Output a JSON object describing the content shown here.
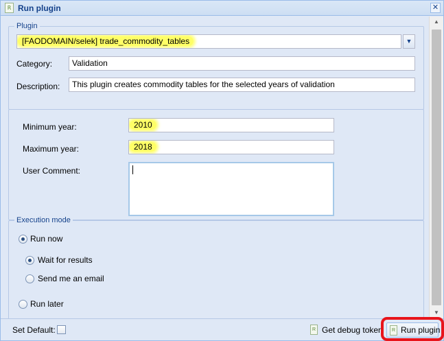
{
  "window": {
    "title": "Run plugin",
    "title_icon": "plugin-icon",
    "close_icon": "close-icon"
  },
  "plugin_section": {
    "legend": "Plugin",
    "selected_prefix": "[FAODOMAIN/selek]",
    "selected_name": "trade_commodity_tables",
    "category_label": "Category:",
    "category_value": "Validation",
    "description_label": "Description:",
    "description_value": "This plugin creates commodity tables for the selected years of validation"
  },
  "params_section": {
    "min_year_label": "Minimum year:",
    "min_year_value": "2010",
    "max_year_label": "Maximum year:",
    "max_year_value": "2018",
    "comment_label": "User Comment:",
    "comment_value": ""
  },
  "execution_section": {
    "legend": "Execution mode",
    "run_now": "Run now",
    "wait_for_results": "Wait for results",
    "send_email": "Send me an email",
    "run_later": "Run later",
    "selected_mode": "Run now",
    "selected_notify": "Wait for results"
  },
  "footer": {
    "set_default_label": "Set Default:",
    "set_default_checked": false,
    "debug_label": "Get debug token",
    "run_label": "Run plugin"
  },
  "colors": {
    "highlight": "#ffff66",
    "annotation_ring": "#e8141b",
    "title_text": "#15428b"
  }
}
